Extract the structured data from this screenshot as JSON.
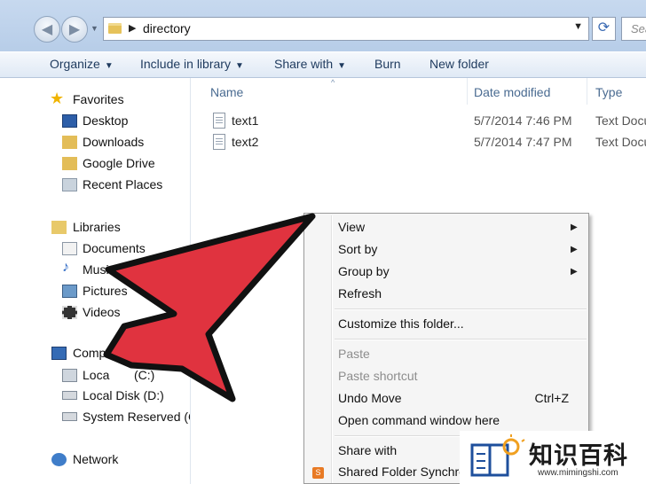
{
  "address": {
    "path": "directory"
  },
  "search": {
    "placeholder": "Sea"
  },
  "toolbar": {
    "organize": "Organize",
    "include": "Include in library",
    "share": "Share with",
    "burn": "Burn",
    "new_folder": "New folder"
  },
  "nav": {
    "favorites": "Favorites",
    "desktop": "Desktop",
    "downloads": "Downloads",
    "google_drive": "Google Drive",
    "recent": "Recent Places",
    "libraries": "Libraries",
    "documents": "Documents",
    "music": "Music",
    "pictures": "Pictures",
    "videos": "Videos",
    "computer": "Comp",
    "local_c": "Loca",
    "local_c_suffix": "(C:)",
    "local_d": "Local Disk (D:)",
    "system_reserved": "System Reserved (G:",
    "network": "Network"
  },
  "files": {
    "headers": {
      "name": "Name",
      "date": "Date modified",
      "type": "Type"
    },
    "rows": [
      {
        "name": "text1",
        "date": "5/7/2014 7:46 PM",
        "type": "Text Docu"
      },
      {
        "name": "text2",
        "date": "5/7/2014 7:47 PM",
        "type": "Text Docu"
      }
    ]
  },
  "menu": {
    "view": "View",
    "sort_by": "Sort by",
    "group_by": "Group by",
    "refresh": "Refresh",
    "customize": "Customize this folder...",
    "paste": "Paste",
    "paste_shortcut": "Paste shortcut",
    "undo_move": "Undo Move",
    "undo_shortcut": "Ctrl+Z",
    "open_cmd": "Open command window here",
    "share_with": "Share with",
    "shared_folder": "Shared Folder Synchroni"
  },
  "watermark": {
    "brand": "知识百科",
    "url": "www.mimingshi.com"
  },
  "colors": {
    "arrow": "#e0333f",
    "accent": "#1e3a5e"
  }
}
